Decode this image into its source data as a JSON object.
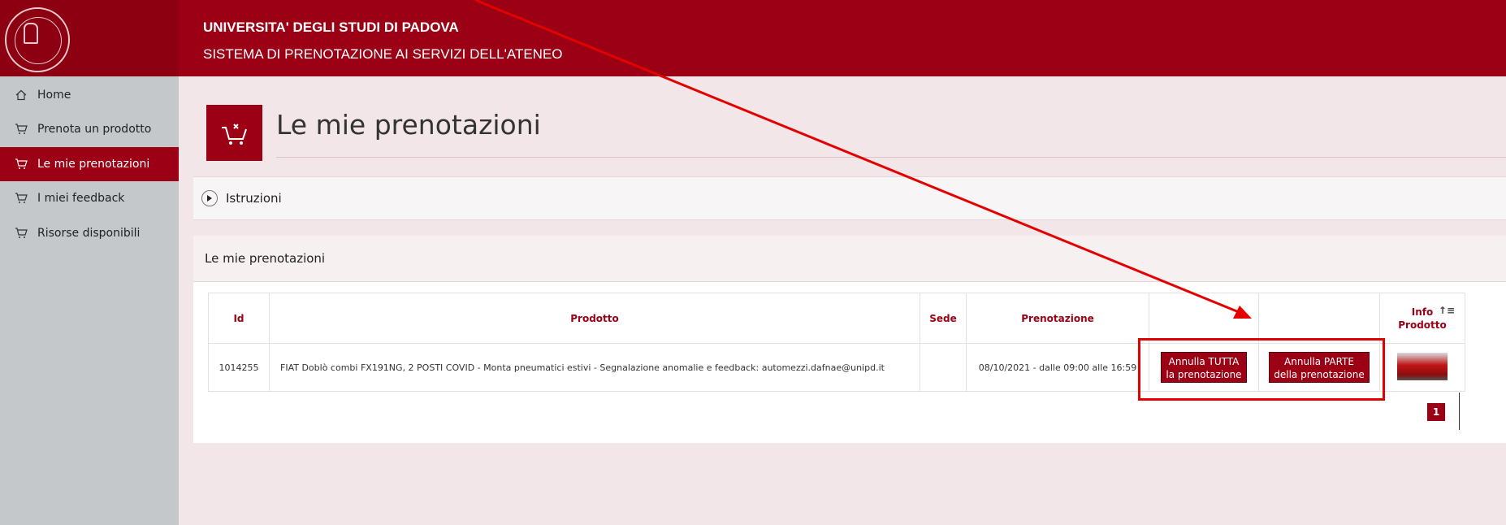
{
  "header": {
    "university": "UNIVERSITA' DEGLI STUDI DI PADOVA",
    "system": "SISTEMA DI PRENOTAZIONE AI SERVIZI DELL'ATENEO"
  },
  "sidebar": {
    "items": [
      {
        "label": "Home",
        "icon": "home-icon"
      },
      {
        "label": "Prenota un prodotto",
        "icon": "cart-icon"
      },
      {
        "label": "Le mie prenotazioni",
        "icon": "cart-x-icon",
        "active": true
      },
      {
        "label": "I miei feedback",
        "icon": "cart-icon"
      },
      {
        "label": "Risorse disponibili",
        "icon": "cart-icon"
      }
    ]
  },
  "page": {
    "title": "Le mie prenotazioni",
    "instructions_label": "Istruzioni"
  },
  "card": {
    "title": "Le mie prenotazioni",
    "table": {
      "headers": [
        "Id",
        "Prodotto",
        "Sede",
        "Prenotazione",
        "",
        "",
        "Info Prodotto"
      ],
      "rows": [
        {
          "id": "1014255",
          "prodotto": "FIAT Doblò combi FX191NG, 2 POSTI COVID - Monta pneumatici estivi - Segnalazione anomalie e feedback: automezzi.dafnae@unipd.it",
          "sede": "",
          "prenotazione": "08/10/2021 - dalle 09:00 alle 16:59",
          "annulla_tutta_line1": "Annulla TUTTA",
          "annulla_tutta_line2": "la prenotazione",
          "annulla_parte_line1": "Annulla PARTE",
          "annulla_parte_line2": "della prenotazione"
        }
      ]
    },
    "pagination": {
      "current": "1"
    }
  },
  "colors": {
    "brand": "#9b0014",
    "sidebar": "#c4c8ca",
    "annotation": "#e30000"
  }
}
